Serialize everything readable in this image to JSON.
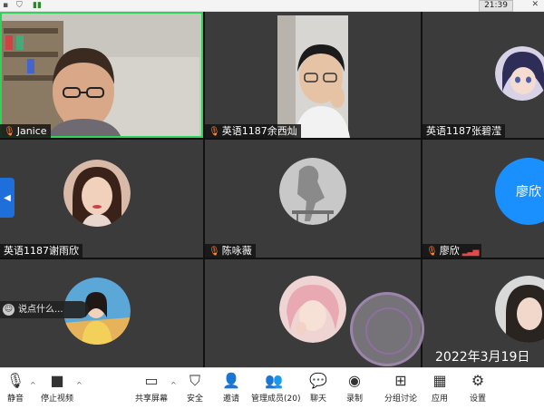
{
  "statusbar": {
    "time": "21:39"
  },
  "participants": [
    {
      "name": "Janice",
      "mic": true
    },
    {
      "name": "英语1187余西灿",
      "mic": true
    },
    {
      "name": "英语1187张碧滢",
      "mic": false
    },
    {
      "name": "英语1187谢雨欣",
      "mic": false
    },
    {
      "name": "陈咏薇",
      "mic": true
    },
    {
      "name": "廖欣",
      "mic": true,
      "avatar_text": "廖欣"
    }
  ],
  "chat": {
    "placeholder": "说点什么..."
  },
  "date_stamp": "2022年3月19日",
  "toolbar": {
    "mute": "静音",
    "stop_video": "停止视频",
    "share_screen": "共享屏幕",
    "security": "安全",
    "invite": "邀请",
    "participants": "管理成员(20)",
    "chat": "聊天",
    "record": "录制",
    "discussion": "分组讨论",
    "apps": "应用",
    "settings": "设置"
  },
  "colors": {
    "active_border": "#2fd35a",
    "accent": "#1a90ff",
    "mic_icon": "#ff8a3d"
  }
}
